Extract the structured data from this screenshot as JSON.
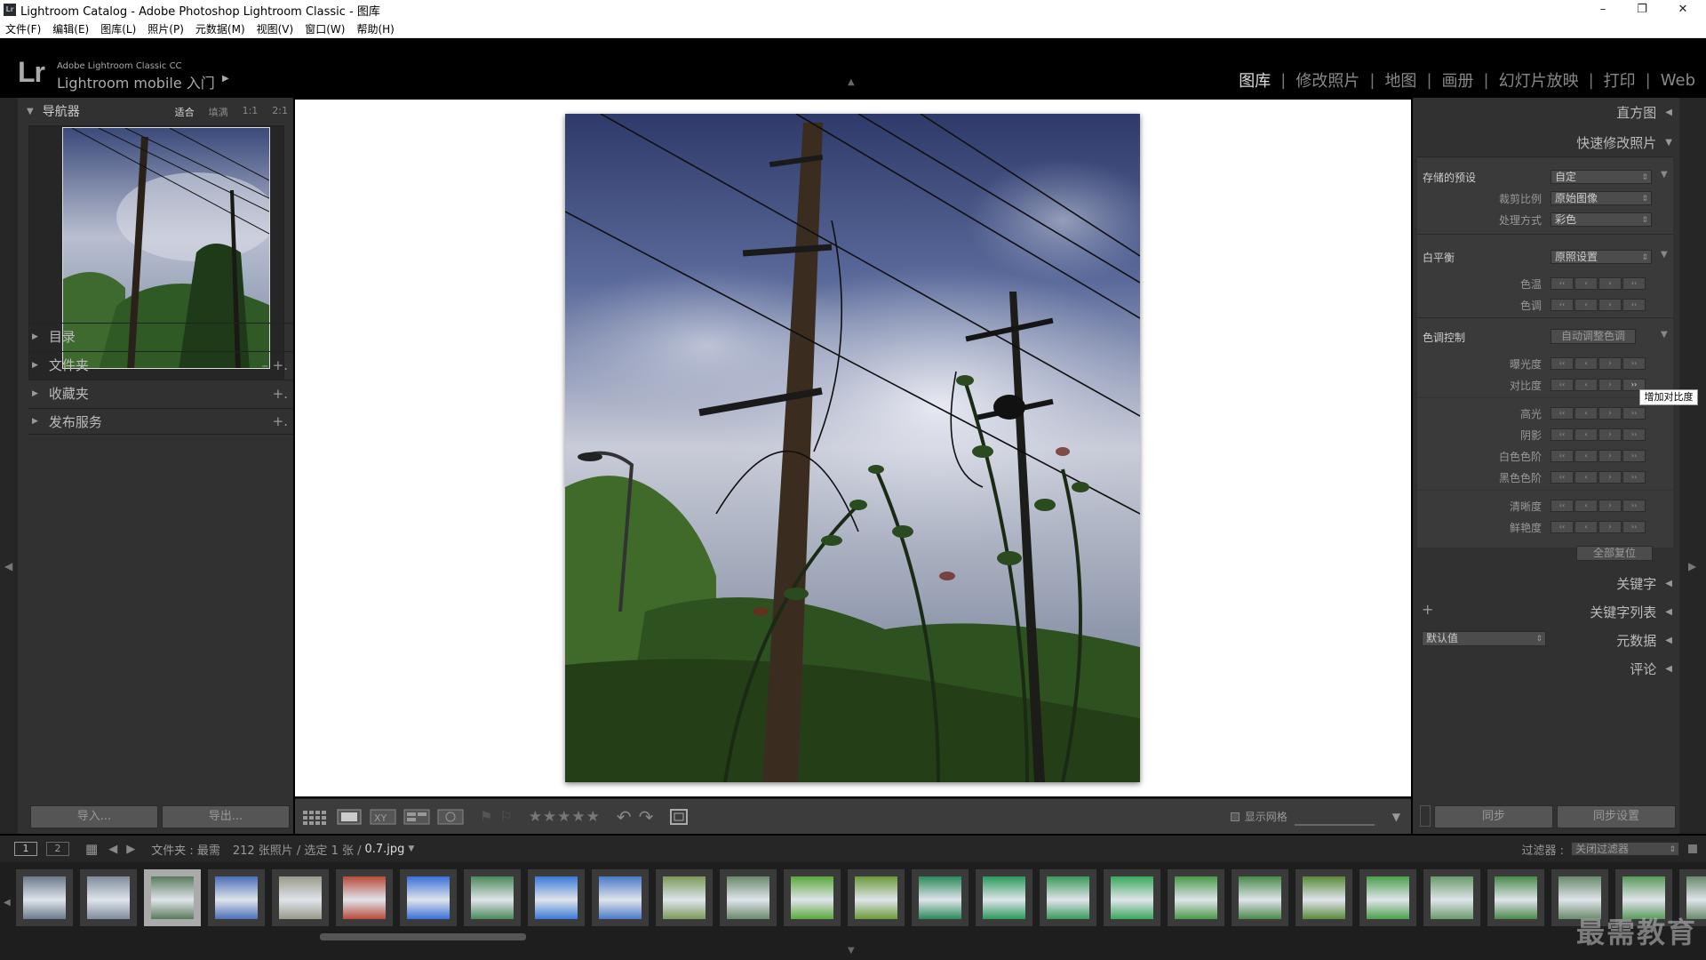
{
  "window": {
    "title": "Lightroom Catalog - Adobe Photoshop Lightroom Classic - 图库",
    "app_icon": "Lr",
    "controls": [
      "–",
      "❐",
      "✕"
    ]
  },
  "menu": [
    "文件(F)",
    "编辑(E)",
    "图库(L)",
    "照片(P)",
    "元数据(M)",
    "视图(V)",
    "窗口(W)",
    "帮助(H)"
  ],
  "identity": {
    "logo": "Lr",
    "line1": "Adobe Lightroom Classic CC",
    "line2": "Lightroom mobile 入门"
  },
  "modules": [
    {
      "label": "图库",
      "active": true
    },
    {
      "label": "修改照片"
    },
    {
      "label": "地图"
    },
    {
      "label": "画册"
    },
    {
      "label": "幻灯片放映"
    },
    {
      "label": "打印"
    },
    {
      "label": "Web"
    }
  ],
  "navigator": {
    "title": "导航器",
    "zoom": [
      "适合",
      "填满",
      "1:1",
      "2:1"
    ]
  },
  "left_sections": [
    {
      "label": "目录"
    },
    {
      "label": "文件夹",
      "actions": "–  +."
    },
    {
      "label": "收藏夹",
      "actions": "+."
    },
    {
      "label": "发布服务",
      "actions": "+."
    }
  ],
  "left_buttons": {
    "import": "导入...",
    "export": "导出..."
  },
  "toolbar": {
    "show_grid": "显示网格"
  },
  "right": {
    "histogram": "直方图",
    "quick_develop": "快速修改照片",
    "saved_preset": "存储的预设",
    "saved_preset_value": "自定",
    "crop_ratio": "裁剪比例",
    "crop_ratio_value": "原始图像",
    "treatment": "处理方式",
    "treatment_value": "彩色",
    "white_balance": "白平衡",
    "white_balance_value": "原照设置",
    "temp": "色温",
    "tint": "色调",
    "tone_control": "色调控制",
    "auto_tone": "自动调整色调",
    "exposure": "曝光度",
    "contrast": "对比度",
    "highlights": "高光",
    "shadows": "阴影",
    "whites": "白色色阶",
    "blacks": "黑色色阶",
    "clarity": "清晰度",
    "vibrance": "鲜艳度",
    "reset_all": "全部复位",
    "keywording": "关键字",
    "keyword_list": "关键字列表",
    "metadata": "元数据",
    "metadata_preset": "默认值",
    "comments": "评论",
    "tooltip": "增加对比度",
    "sync": "同步",
    "sync_settings": "同步设置"
  },
  "filmstrip": {
    "page1": "1",
    "page2": "2",
    "source": "文件夹 : 最需",
    "count": "212 张照片 / 选定 1 张 /",
    "filename": "0.7.jpg",
    "filter_label": "过滤器 :",
    "filter_value": "关闭过滤器",
    "watermark": "最需教育"
  },
  "thumb_colors": [
    "#6a7a8c",
    "#7f8c9c",
    "#5a7a5c",
    "#4a6fb8",
    "#9a9a8a",
    "#b84a3a",
    "#3a6fd8",
    "#4a8a5a",
    "#3a7ad8",
    "#4a7ac8",
    "#7a9a5a",
    "#6a8a6a",
    "#5aa83a",
    "#6a9a3a",
    "#2a8a5a",
    "#2a9a5a",
    "#3a9a5a",
    "#3aa85a",
    "#4a9a4a",
    "#4a8a4a",
    "#5a8a3a",
    "#4aa04a",
    "#6a9a6a",
    "#4a8a4a",
    "#6a8a6a",
    "#5a9a5a",
    "#6a8a6a"
  ]
}
